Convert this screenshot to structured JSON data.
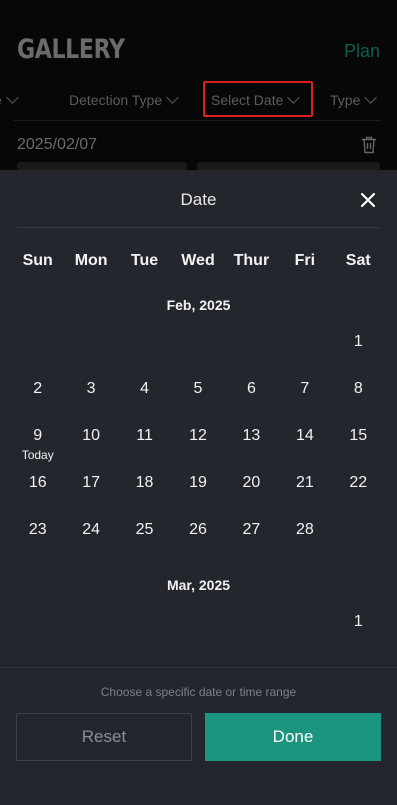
{
  "background": {
    "title": "GALLERY",
    "plan_link": "Plan",
    "filters": [
      "e",
      "Detection Type",
      "Select Date",
      "Type"
    ],
    "selected_date": "2025/02/07"
  },
  "sheet": {
    "title": "Date",
    "weekdays": [
      "Sun",
      "Mon",
      "Tue",
      "Wed",
      "Thur",
      "Fri",
      "Sat"
    ],
    "months": [
      {
        "label": "Feb, 2025",
        "weeks": [
          [
            "",
            "",
            "",
            "",
            "",
            "",
            "1"
          ],
          [
            "2",
            "3",
            "4",
            "5",
            "6",
            "7",
            "8"
          ],
          [
            "9",
            "10",
            "11",
            "12",
            "13",
            "14",
            "15"
          ],
          [
            "16",
            "17",
            "18",
            "19",
            "20",
            "21",
            "22"
          ],
          [
            "23",
            "24",
            "25",
            "26",
            "27",
            "28",
            ""
          ]
        ],
        "today": "9",
        "today_label": "Today"
      },
      {
        "label": "Mar, 2025",
        "weeks": [
          [
            "",
            "",
            "",
            "",
            "",
            "",
            "1"
          ]
        ]
      }
    ],
    "hint": "Choose a specific date or time range",
    "reset_label": "Reset",
    "done_label": "Done"
  },
  "colors": {
    "accent": "#1b9580",
    "sheet_bg": "#23262d",
    "highlight": "#d9231e"
  }
}
